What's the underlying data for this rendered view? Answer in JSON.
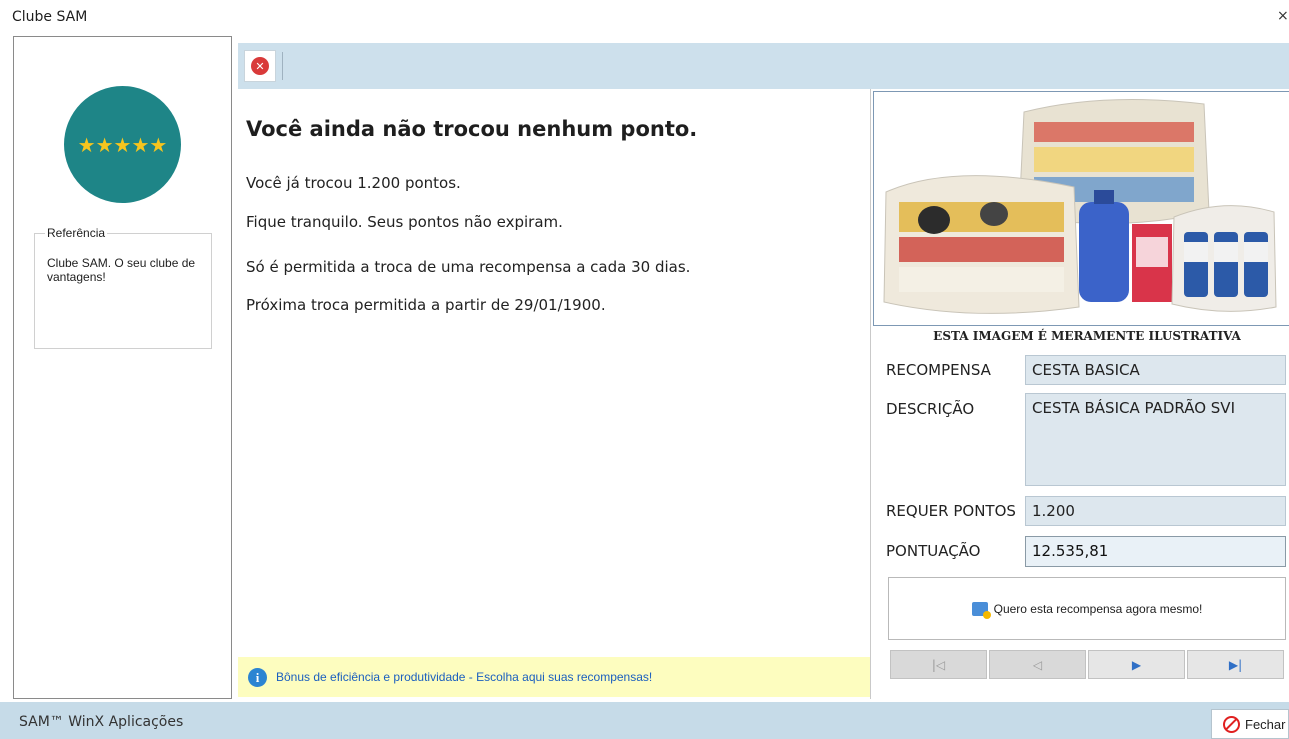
{
  "window": {
    "title": "Clube SAM",
    "close_glyph": "×"
  },
  "left_panel": {
    "badge_stars": "★★★★★",
    "group_label": "Referência",
    "group_text": "Clube SAM. O seu clube de vantagens!"
  },
  "toolbar": {
    "close_icon": "close-circle-red"
  },
  "main": {
    "heading": "Você ainda não trocou nenhum ponto.",
    "line1": "Você já trocou 1.200 pontos.",
    "line2": "Fique tranquilo. Seus pontos não expiram.",
    "line3": "Só é permitida a troca de uma recompensa a cada 30 dias.",
    "line4": "Próxima troca permitida a partir de 29/01/1900.",
    "info_link": "Bônus de eficiência e produtividade - Escolha aqui suas recompensas!"
  },
  "reward": {
    "image_caption": "ESTA IMAGEM É MERAMENTE ILUSTRATIVA",
    "fields": {
      "recompensa_label": "RECOMPENSA",
      "recompensa_value": "CESTA BASICA",
      "descricao_label": "DESCRIÇÃO",
      "descricao_value": "CESTA BÁSICA PADRÃO SVI",
      "requer_label": "REQUER PONTOS",
      "requer_value": "1.200",
      "pontuacao_label": "PONTUAÇÃO",
      "pontuacao_value": "12.535,81"
    },
    "action_label": "Quero esta recompensa agora mesmo!",
    "nav": {
      "first": "|◁",
      "prev": "◁",
      "next": "▶",
      "last": "▶|"
    }
  },
  "status": {
    "app_name": "SAM™ WinX Aplicações",
    "close_button": "Fechar"
  }
}
